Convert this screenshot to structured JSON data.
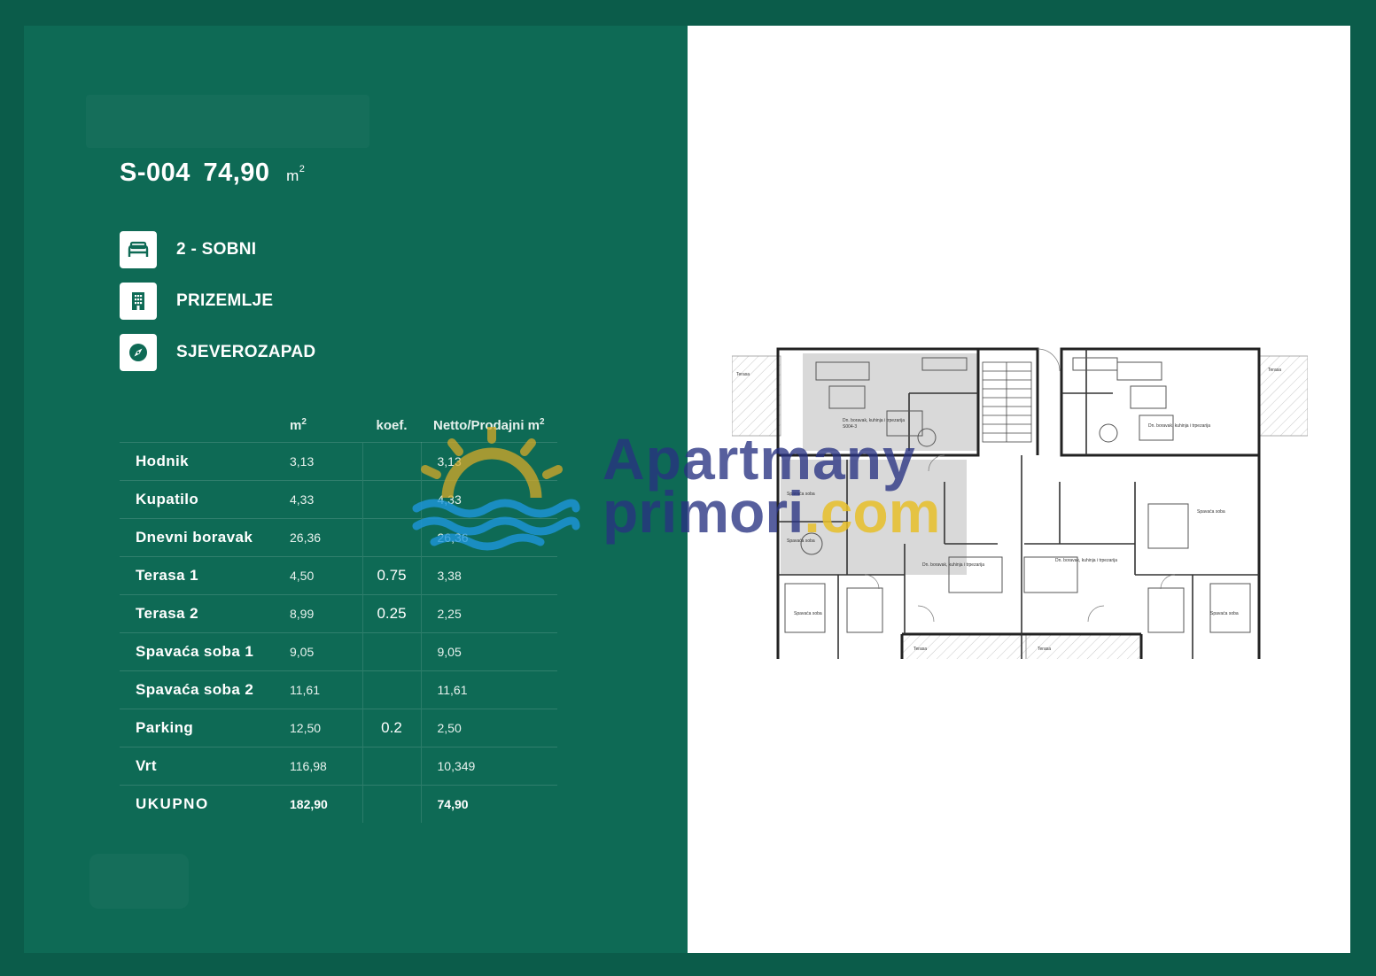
{
  "unit": {
    "code": "S-004",
    "area": "74,90",
    "area_unit": "m",
    "area_unit_sup": "2"
  },
  "features": [
    {
      "icon": "bed-icon",
      "label": "2 - SOBNI"
    },
    {
      "icon": "building-icon",
      "label": "PRIZEMLJE"
    },
    {
      "icon": "compass-icon",
      "label": "SJEVEROZAPAD"
    }
  ],
  "table": {
    "headers": {
      "area": "m",
      "area_sup": "2",
      "koef": "koef.",
      "net": "Netto/Prodajni m",
      "net_sup": "2"
    },
    "rows": [
      {
        "name": "Hodnik",
        "area": "3,13",
        "koef": "",
        "net": "3,13"
      },
      {
        "name": "Kupatilo",
        "area": "4,33",
        "koef": "",
        "net": "4,33"
      },
      {
        "name": "Dnevni boravak",
        "area": "26,36",
        "koef": "",
        "net": "26,36"
      },
      {
        "name": "Terasa 1",
        "area": "4,50",
        "koef": "0.75",
        "net": "3,38"
      },
      {
        "name": "Terasa 2",
        "area": "8,99",
        "koef": "0.25",
        "net": "2,25"
      },
      {
        "name": "Spavaća soba 1",
        "area": "9,05",
        "koef": "",
        "net": "9,05"
      },
      {
        "name": "Spavaća soba 2",
        "area": "11,61",
        "koef": "",
        "net": "11,61"
      },
      {
        "name": "Parking",
        "area": "12,50",
        "koef": "0.2",
        "net": "2,50"
      },
      {
        "name": "Vrt",
        "area": "116,98",
        "koef": "",
        "net": "10,349"
      },
      {
        "name": "UKUPNO",
        "area": "182,90",
        "koef": "",
        "net": "74,90"
      }
    ]
  },
  "watermark": {
    "line1": "Apartmany",
    "line2_a": "primori",
    "line2_b": ".com"
  },
  "colors": {
    "background": "#0b5c4a",
    "panel": "#0e6a55",
    "highlight_unit": "#d6d6d6",
    "watermark_blue": "#283282",
    "watermark_gold": "#e6be28"
  }
}
